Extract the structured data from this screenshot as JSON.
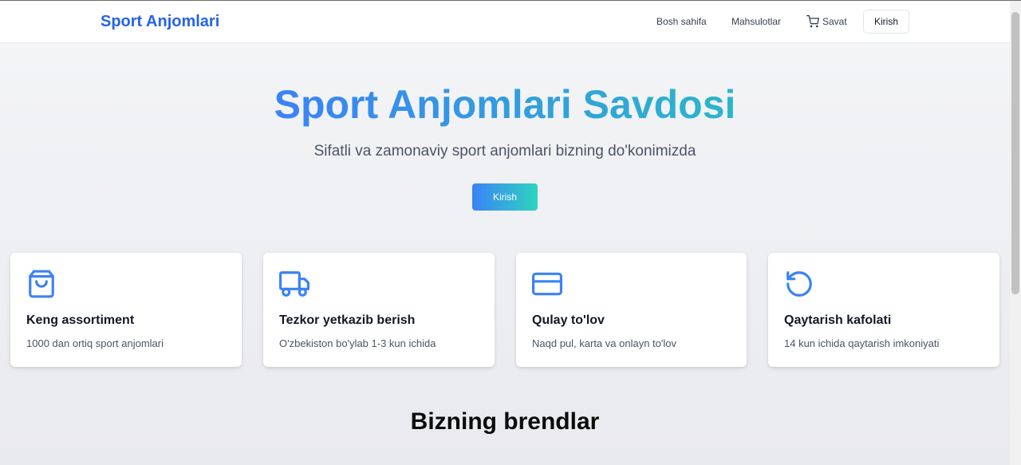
{
  "navbar": {
    "brand": "Sport Anjomlari",
    "links": {
      "home": "Bosh sahifa",
      "products": "Mahsulotlar",
      "cart": "Savat"
    },
    "login": "Kirish"
  },
  "hero": {
    "title": "Sport Anjomlari Savdosi",
    "subtitle": "Sifatli va zamonaviy sport anjomlari bizning do'konimizda",
    "cta": "Kirish"
  },
  "features": [
    {
      "icon": "shopping-bag-icon",
      "title": "Keng assortiment",
      "desc": "1000 dan ortiq sport anjomlari"
    },
    {
      "icon": "truck-icon",
      "title": "Tezkor yetkazib berish",
      "desc": "O'zbekiston bo'ylab 1-3 kun ichida"
    },
    {
      "icon": "credit-card-icon",
      "title": "Qulay to'lov",
      "desc": "Naqd pul, karta va onlayn to'lov"
    },
    {
      "icon": "rotate-ccw-icon",
      "title": "Qaytarish kafolati",
      "desc": "14 kun ichida qaytarish imkoniyati"
    }
  ],
  "brands": {
    "title": "Bizning brendlar"
  },
  "colors": {
    "primary": "#2563eb",
    "gradient_start": "#3b82f6",
    "gradient_end": "#2dd4bf",
    "icon": "#3b82f6"
  }
}
